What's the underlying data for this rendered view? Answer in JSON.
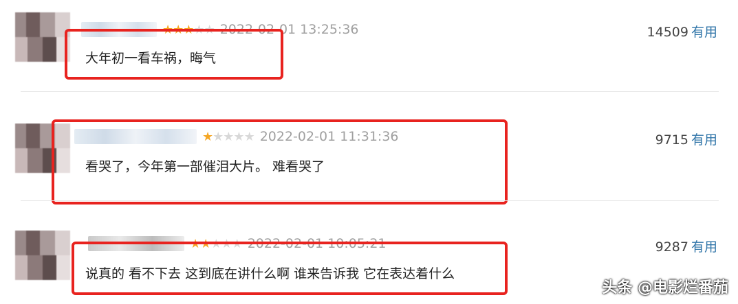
{
  "reviews": [
    {
      "stars_on": 3,
      "stars_total": 5,
      "timestamp": "2022-02-01 13:25:36",
      "helpful_count": "14509",
      "helpful_label": "有用",
      "content": "大年初一看车祸，晦气"
    },
    {
      "stars_on": 1,
      "stars_total": 5,
      "timestamp": "2022-02-01 11:31:36",
      "helpful_count": "9715",
      "helpful_label": "有用",
      "content": "看哭了，今年第一部催泪大片。 难看哭了"
    },
    {
      "stars_on": 2,
      "stars_total": 5,
      "timestamp": "2022-02-01 10:05:21",
      "helpful_count": "9287",
      "helpful_label": "有用",
      "content": "说真的 看不下去 这到底在讲什么啊 谁来告诉我 它在表达着什么"
    }
  ],
  "watermark": "头条 @电影烂番茄",
  "colors": {
    "highlight": "#e8231f",
    "star": "#f5a623",
    "link": "#3377aa"
  }
}
